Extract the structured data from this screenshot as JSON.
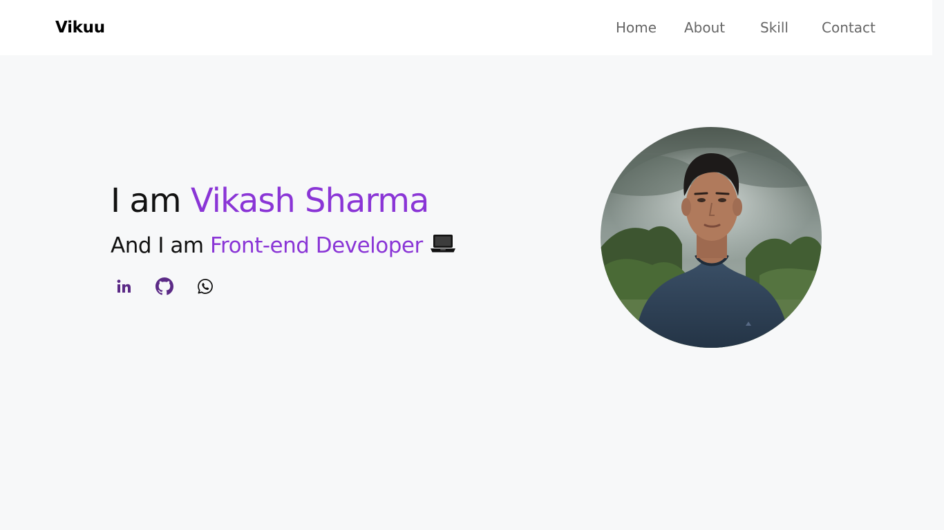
{
  "navbar": {
    "brand": "Vikuu",
    "links": [
      {
        "label": "Home"
      },
      {
        "label": "About"
      },
      {
        "label": "Skill"
      },
      {
        "label": "Contact"
      }
    ]
  },
  "hero": {
    "intro_prefix": "I am ",
    "name": "Vikash Sharma",
    "role_prefix": "And I am ",
    "role": "Front-end Developer",
    "role_icon": "laptop-icon",
    "social_links": [
      {
        "icon": "linkedin-icon"
      },
      {
        "icon": "github-icon"
      },
      {
        "icon": "whatsapp-icon"
      }
    ],
    "avatar_icon": "profile-photo"
  },
  "colors": {
    "accent": "#8a35d6",
    "social_icon": "#5b2a86",
    "nav_text": "#666666",
    "page_bg": "#f7f8f9",
    "navbar_bg": "#ffffff"
  }
}
